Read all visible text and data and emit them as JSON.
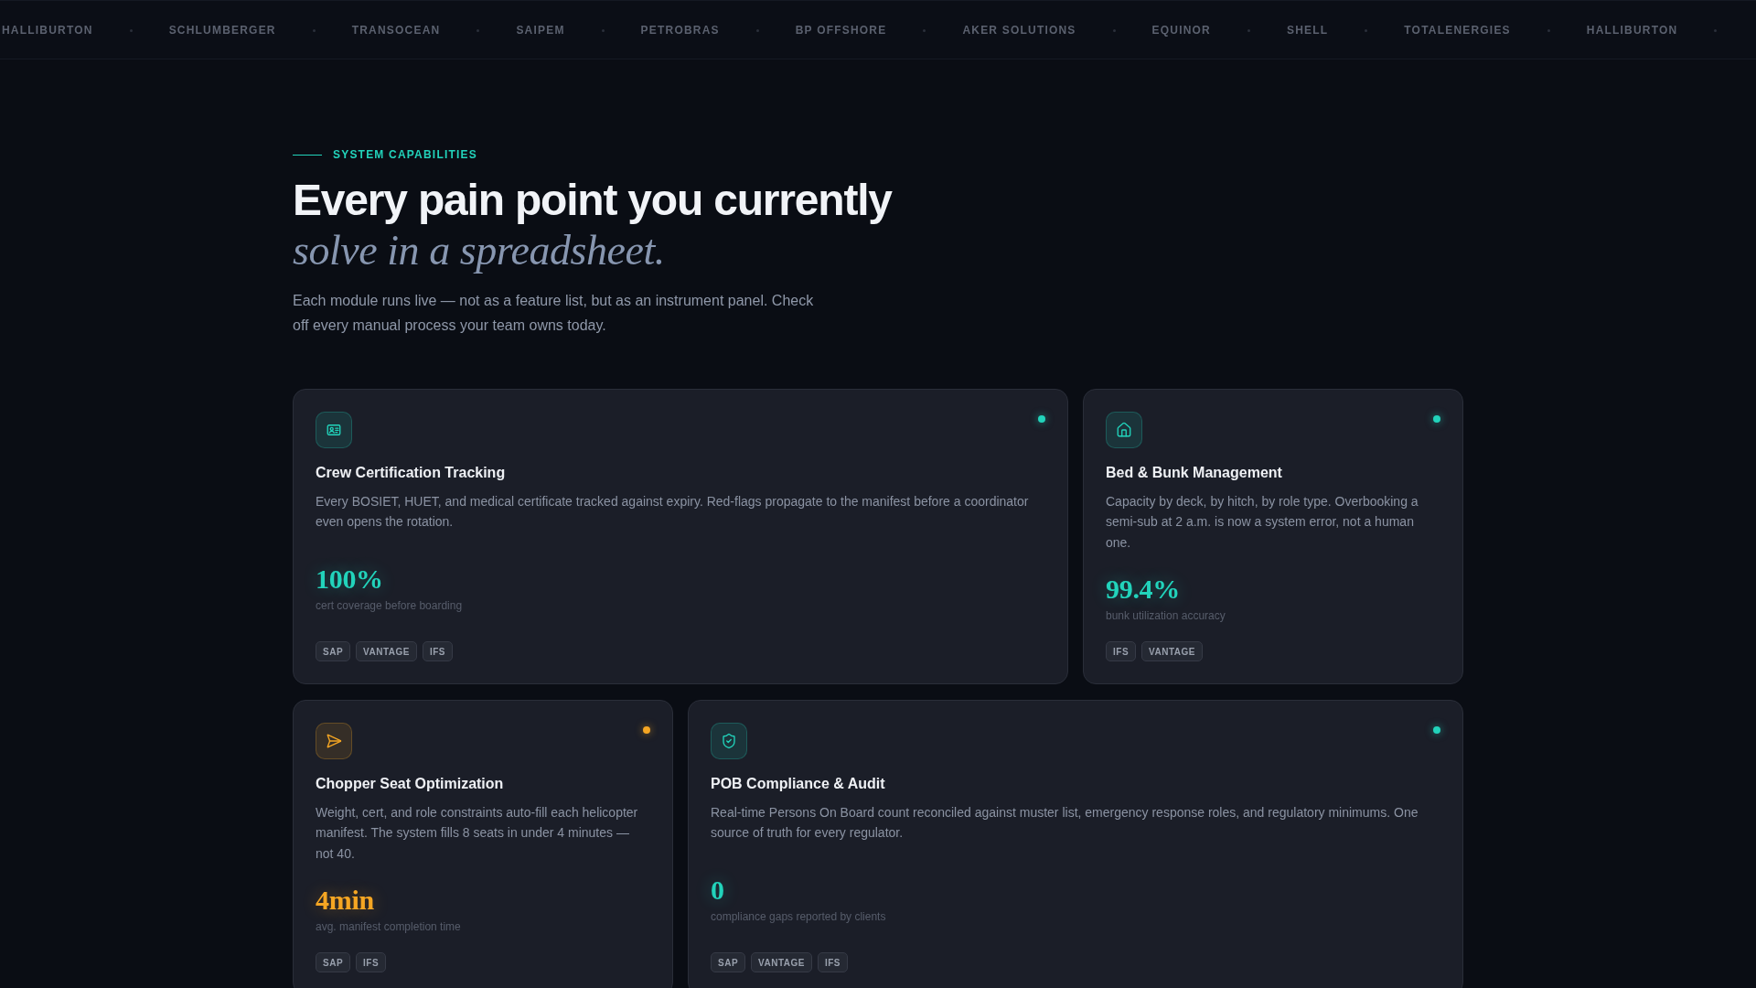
{
  "marquee": {
    "logos": [
      "HALLIBURTON",
      "SCHLUMBERGER",
      "TRANSOCEAN",
      "SAIPEM",
      "PETROBRAS",
      "BP OFFSHORE",
      "AKER SOLUTIONS",
      "EQUINOR",
      "SHELL",
      "TOTALENERGIES",
      "HALLIBURTON"
    ]
  },
  "section": {
    "eyebrow": "SYSTEM CAPABILITIES",
    "heading": "Every pain point you currently *solve in a spreadsheet.*",
    "intro": "Each module runs live — not as a feature list, but as an instrument panel. Check off every manual process your team owns today."
  },
  "cards": [
    {
      "title": "Crew Certification Tracking",
      "description": "Every BOSIET, HUET, and medical certificate tracked against expiry. Red-flags propagate to the manifest before a coordinator even opens the rotation.",
      "metric": "100%",
      "metric_label": "cert coverage before boarding",
      "tags": [
        "SAP",
        "VANTAGE",
        "IFS"
      ],
      "color": "#22d3bb"
    },
    {
      "title": "Bed & Bunk Management",
      "description": "Capacity by deck, by hitch, by role type. Overbooking a semi-sub at 2 a.m. is now a system error, not a human one.",
      "metric": "99.4%",
      "metric_label": "bunk utilization accuracy",
      "tags": [
        "IFS",
        "VANTAGE"
      ],
      "color": "#22d3bb"
    },
    {
      "title": "Chopper Seat Optimization",
      "description": "Weight, cert, and role constraints auto-fill each helicopter manifest. The system fills 8 seats in under 4 minutes — not 40.",
      "metric": "4min",
      "metric_label": "avg. manifest completion time",
      "tags": [
        "SAP",
        "IFS"
      ],
      "color": "#f5a623"
    },
    {
      "title": "POB Compliance & Audit",
      "description": "Real-time Persons On Board count reconciled against muster list, emergency response roles, and regulatory minimums. One source of truth for every regulator.",
      "metric": "0",
      "metric_label": "compliance gaps reported by clients",
      "tags": [
        "SAP",
        "VANTAGE",
        "IFS"
      ],
      "color": "#22d3bb"
    }
  ]
}
